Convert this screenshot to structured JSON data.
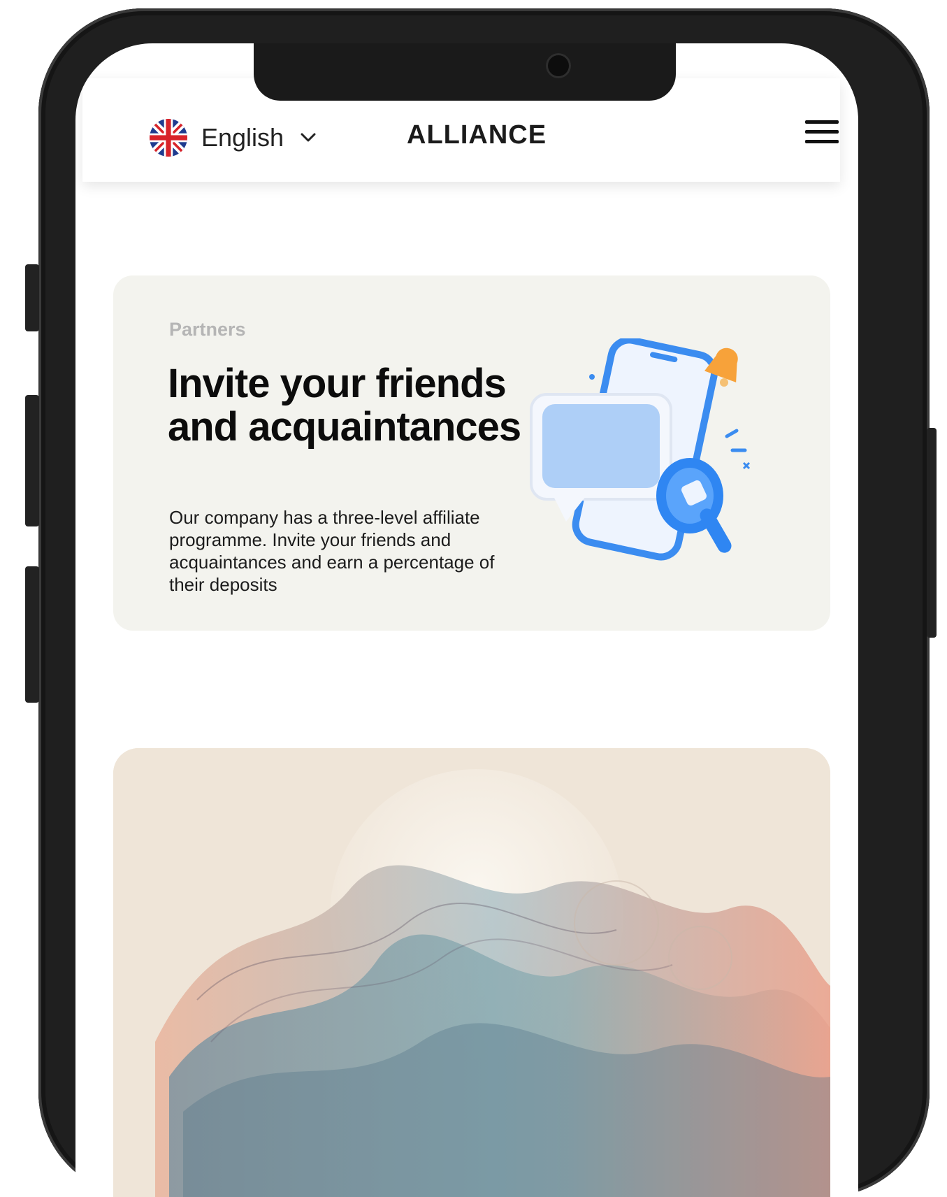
{
  "header": {
    "language": {
      "label": "English",
      "flag_icon": "uk-flag-icon"
    },
    "brand": "ALLIANCE",
    "menu_icon": "hamburger-menu-icon"
  },
  "partners_card": {
    "eyebrow": "Partners",
    "headline": "Invite your friends and acquaintances",
    "description": "Our company has a three-level affiliate programme. Invite your friends and acquaintances and earn a percentage of their deposits",
    "illustration": "megaphone-phone-chat-illustration"
  },
  "artwork_card": {
    "illustration": "abstract-wave-smoke-artwork"
  },
  "colors": {
    "card_bg": "#f3f3ee",
    "eyebrow": "#b5b5b5",
    "accent_blue": "#2f8cf5",
    "accent_orange": "#f7a23a",
    "art_bg": "#efe5d8"
  }
}
